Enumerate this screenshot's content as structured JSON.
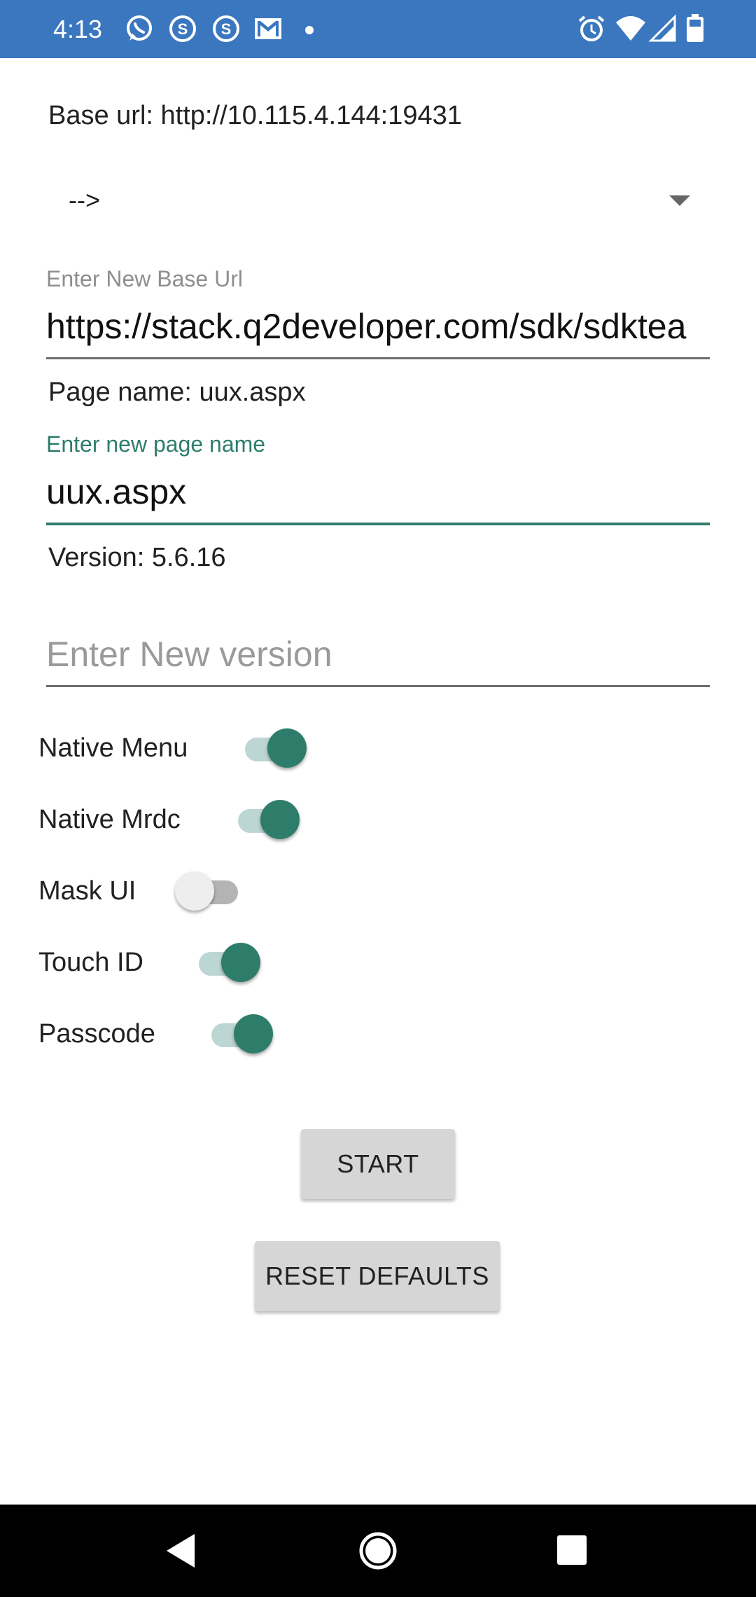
{
  "status_bar": {
    "time": "4:13",
    "left_icons": [
      "whatsapp-icon",
      "app-s-icon",
      "app-s-icon",
      "gmail-icon",
      "dot-icon"
    ],
    "right_icons": [
      "alarm-icon",
      "wifi-icon",
      "signal-icon",
      "battery-icon"
    ]
  },
  "base_url": {
    "label": "Base url: http://10.115.4.144:19431"
  },
  "dropdown": {
    "selected": "-->"
  },
  "new_base_url": {
    "hint": "Enter New Base Url",
    "value": "https://stack.q2developer.com/sdk/sdktea"
  },
  "page_name": {
    "label": "Page name: uux.aspx"
  },
  "new_page_name": {
    "hint": "Enter new page name",
    "value": "uux.aspx"
  },
  "version": {
    "label": "Version: 5.6.16"
  },
  "new_version": {
    "placeholder": "Enter New version",
    "value": ""
  },
  "toggles": [
    {
      "label": "Native Menu",
      "on": true
    },
    {
      "label": "Native Mrdc",
      "on": true
    },
    {
      "label": "Mask UI",
      "on": false
    },
    {
      "label": "Touch ID",
      "on": true
    },
    {
      "label": "Passcode",
      "on": true
    }
  ],
  "buttons": {
    "start": "START",
    "reset": "RESET DEFAULTS"
  },
  "colors": {
    "status_bar": "#3a77bf",
    "accent": "#2e7d6b",
    "button": "#d6d6d6"
  }
}
